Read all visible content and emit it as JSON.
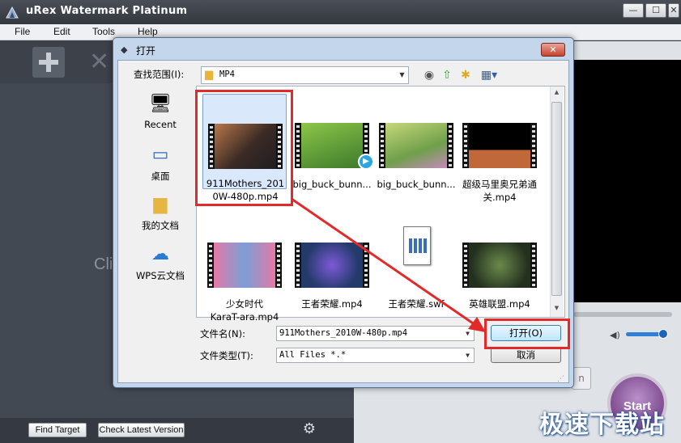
{
  "app": {
    "title": "uRex Watermark Platinum",
    "window_controls": {
      "minimize": "—",
      "maximize": "☐",
      "close": "✕"
    },
    "menu": [
      "File",
      "Edit",
      "Tools",
      "Help"
    ],
    "toolbar": {
      "add_icon": "plus-icon",
      "remove_icon": "x-icon",
      "remove_glyph": "✕"
    },
    "hint_text": "Cli",
    "preview": {
      "progress": 0.0,
      "volume": 0.85
    },
    "buttons": {
      "right_panel_partial": "n",
      "start": "Start"
    },
    "bottom": {
      "find_target": "Find Target",
      "check_version": "Check Latest Version",
      "gear_glyph": "⚙"
    },
    "watermark_text": "极速下载站"
  },
  "dialog": {
    "title": "打开",
    "close_glyph": "✕",
    "look_in_label": "查找范围(I):",
    "look_in_value": "MP4",
    "toolbar_icons": [
      "back-icon",
      "up-folder-icon",
      "new-folder-icon",
      "view-menu-icon"
    ],
    "places": [
      {
        "label": "Recent",
        "icon": "recent-icon"
      },
      {
        "label": "桌面",
        "icon": "desktop-icon"
      },
      {
        "label": "我的文档",
        "icon": "documents-icon"
      },
      {
        "label": "WPS云文档",
        "icon": "cloud-icon"
      }
    ],
    "files": [
      {
        "name": "911Mothers_2010W-480p.mp4",
        "line1": "911Mothers_201",
        "line2": "0W-480p.mp4",
        "selected": true
      },
      {
        "name": "big_buck_bunn...",
        "line1": "big_buck_bunn...",
        "line2": "",
        "selected": false
      },
      {
        "name": "big_buck_bunn...",
        "line1": "big_buck_bunn...",
        "line2": "",
        "selected": false
      },
      {
        "name": "超级马里奥兄弟通关.mp4",
        "line1": "超级马里奥兄弟通",
        "line2": "关.mp4",
        "selected": false
      },
      {
        "name": "少女时代 KaraT-ara.mp4",
        "line1": "少女时代",
        "line2": "KaraT-ara.mp4",
        "selected": false
      },
      {
        "name": "王者荣耀.mp4",
        "line1": "王者荣耀.mp4",
        "line2": "",
        "selected": false
      },
      {
        "name": "王者荣耀.swf",
        "line1": "王者荣耀.swf",
        "line2": "",
        "selected": false
      },
      {
        "name": "英雄联盟.mp4",
        "line1": "英雄联盟.mp4",
        "line2": "",
        "selected": false
      }
    ],
    "file_name_label": "文件名(N):",
    "file_name_value": "911Mothers_2010W-480p.mp4",
    "file_type_label": "文件类型(T):",
    "file_type_value": "All Files *.*",
    "open_button": "打开(O)",
    "cancel_button": "取消"
  },
  "colors": {
    "highlight": "#e22a2a",
    "dialog_frame": "#c3d6ec",
    "app_dark": "#434953"
  }
}
